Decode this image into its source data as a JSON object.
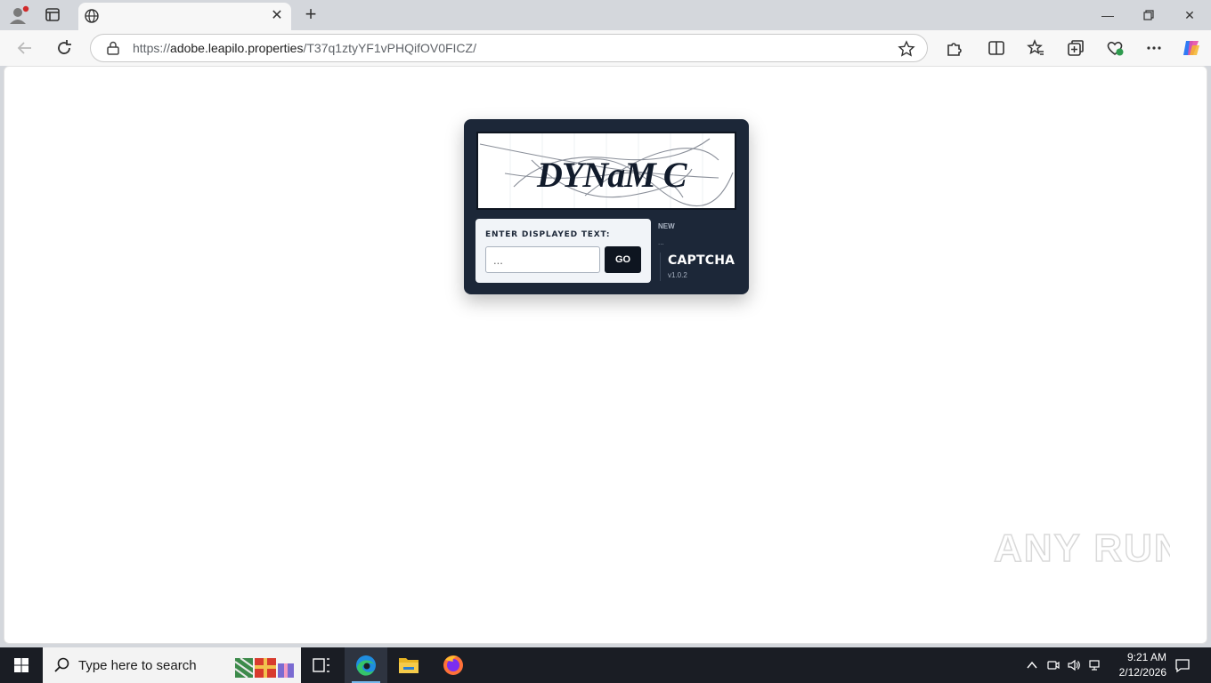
{
  "browser": {
    "tab_title": "",
    "address": {
      "scheme": "https://",
      "host": "adobe.leapilo.properties",
      "path": "/T37q1ztyYF1vPHQifOV0FICZ/"
    }
  },
  "captcha": {
    "image_text": "DYNaM C",
    "input_label": "ENTER DISPLAYED TEXT:",
    "input_placeholder": "...",
    "go_label": "GO",
    "new_label": "NEW",
    "dots_label": "...",
    "brand": "CAPTCHA",
    "version": "v1.0.2"
  },
  "watermark": {
    "text": "ANY RUN"
  },
  "taskbar": {
    "search_placeholder": "Type here to search",
    "time": "9:21 AM",
    "date": "2/12/2026"
  },
  "colors": {
    "widget_bg": "#1c2738",
    "button_bg": "#0e1520",
    "panel_bg": "#f1f4f8",
    "taskbar_bg": "#1a1d24"
  },
  "icons": {
    "profile": "profile-icon",
    "tab_actions": "tab-actions-icon",
    "tab_favicon": "globe-icon",
    "back": "back-arrow-icon",
    "refresh": "refresh-icon",
    "lock": "lock-icon",
    "favorite": "star-icon",
    "extensions": "puzzle-icon",
    "split": "split-screen-icon",
    "favorites": "favorites-icon",
    "collections": "collections-icon",
    "performance": "heart-pulse-icon",
    "menu": "more-icon",
    "copilot": "copilot-icon"
  }
}
